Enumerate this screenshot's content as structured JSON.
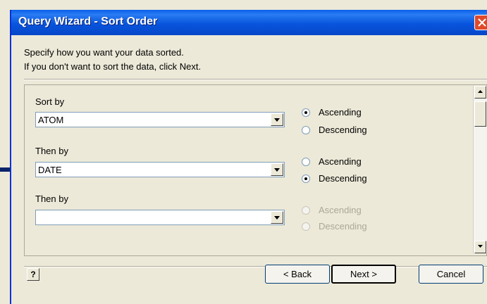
{
  "dialog": {
    "title": "Query Wizard - Sort Order",
    "instructions": [
      "Specify how you want your data sorted.",
      "If you don't want to sort the data, click Next."
    ]
  },
  "sort_rows": [
    {
      "label": "Sort by",
      "field": "ATOM",
      "ascending": "Ascending",
      "descending": "Descending",
      "selected": "ascending",
      "enabled": true
    },
    {
      "label": "Then by",
      "field": "DATE",
      "ascending": "Ascending",
      "descending": "Descending",
      "selected": "descending",
      "enabled": true
    },
    {
      "label": "Then by",
      "field": "",
      "ascending": "Ascending",
      "descending": "Descending",
      "selected": "none",
      "enabled": false
    }
  ],
  "buttons": {
    "help": "?",
    "back": "< Back",
    "next": "Next >",
    "cancel": "Cancel"
  },
  "colors": {
    "titlebar": "#0855dd",
    "dialog_bg": "#ece9d8",
    "close_button": "#e04a2a"
  },
  "icons": {
    "close": "close-icon",
    "combo_arrow": "chevron-down-icon",
    "scroll_up": "chevron-up-icon",
    "scroll_down": "chevron-down-icon",
    "help": "help-icon"
  }
}
